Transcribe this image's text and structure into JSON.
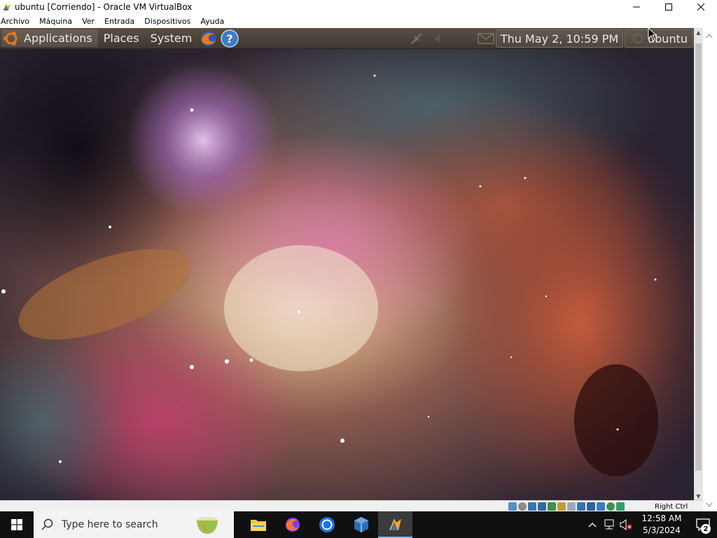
{
  "window": {
    "title": "ubuntu [Corriendo] - Oracle VM VirtualBox",
    "controls": {
      "minimize": "minimize",
      "maximize": "maximize",
      "close": "close"
    }
  },
  "menubar": [
    "Archivo",
    "Máquina",
    "Ver",
    "Entrada",
    "Dispositivos",
    "Ayuda"
  ],
  "guest": {
    "panel": {
      "applications": "Applications",
      "places": "Places",
      "system": "System",
      "launchers": [
        "firefox-icon",
        "help-icon"
      ],
      "clock": "Thu May  2, 10:59 PM",
      "user": "ubuntu"
    },
    "wallpaper": "orion-nebula"
  },
  "vbox_status": {
    "host_key": "Right Ctrl"
  },
  "taskbar": {
    "search_placeholder": "Type here to search",
    "apps": [
      "file-explorer-icon",
      "firefox-icon",
      "chrome-icon",
      "virtualbox-icon",
      "vm-window-icon"
    ],
    "time": "12:58 AM",
    "date": "5/3/2024",
    "notification_count": "2"
  },
  "colors": {
    "panel": "#4a4039",
    "taskbar": "#101010",
    "accent": "#76b9ed"
  }
}
